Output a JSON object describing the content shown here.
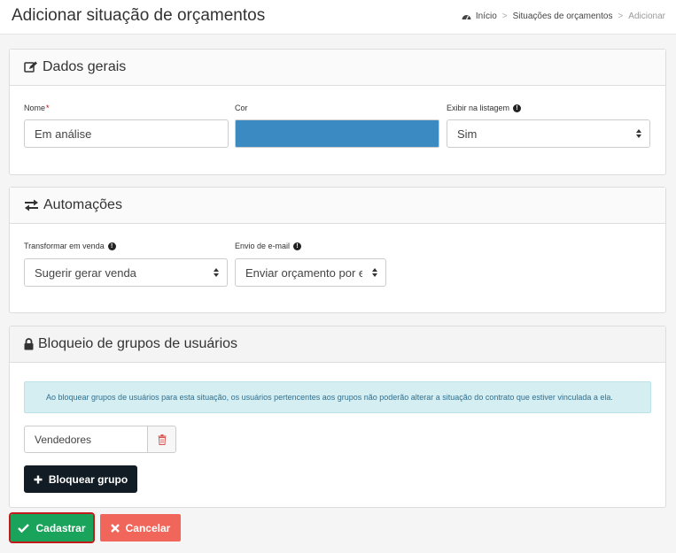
{
  "header": {
    "title": "Adicionar situação de orçamentos",
    "breadcrumb": {
      "home": "Início",
      "section": "Situações de orçamentos",
      "current": "Adicionar",
      "separator": ">"
    }
  },
  "general": {
    "heading": "Dados gerais",
    "name_label": "Nome",
    "name_required_mark": "*",
    "name_value": "Em análise",
    "color_label": "Cor",
    "color_value": "#3b8bc2",
    "list_label": "Exibir na listagem",
    "list_value": "Sim"
  },
  "automation": {
    "heading": "Automações",
    "sale_label": "Transformar em venda",
    "sale_value": "Sugerir gerar venda",
    "email_label": "Envio de e-mail",
    "email_value": "Enviar orçamento por e-mail"
  },
  "block": {
    "heading": "Bloqueio de grupos de usuários",
    "alert": "Ao bloquear grupos de usuários para esta situação, os usuários pertencentes aos grupos não poderão alterar a situação do contrato que estiver vinculada a ela.",
    "group_value": "Vendedores",
    "add_button": "Bloquear grupo"
  },
  "actions": {
    "save": "Cadastrar",
    "cancel": "Cancelar"
  },
  "colors": {
    "save": "#1aa35a",
    "cancel": "#f0665a",
    "dark": "#111c24",
    "info_bg": "#d4eef2"
  }
}
